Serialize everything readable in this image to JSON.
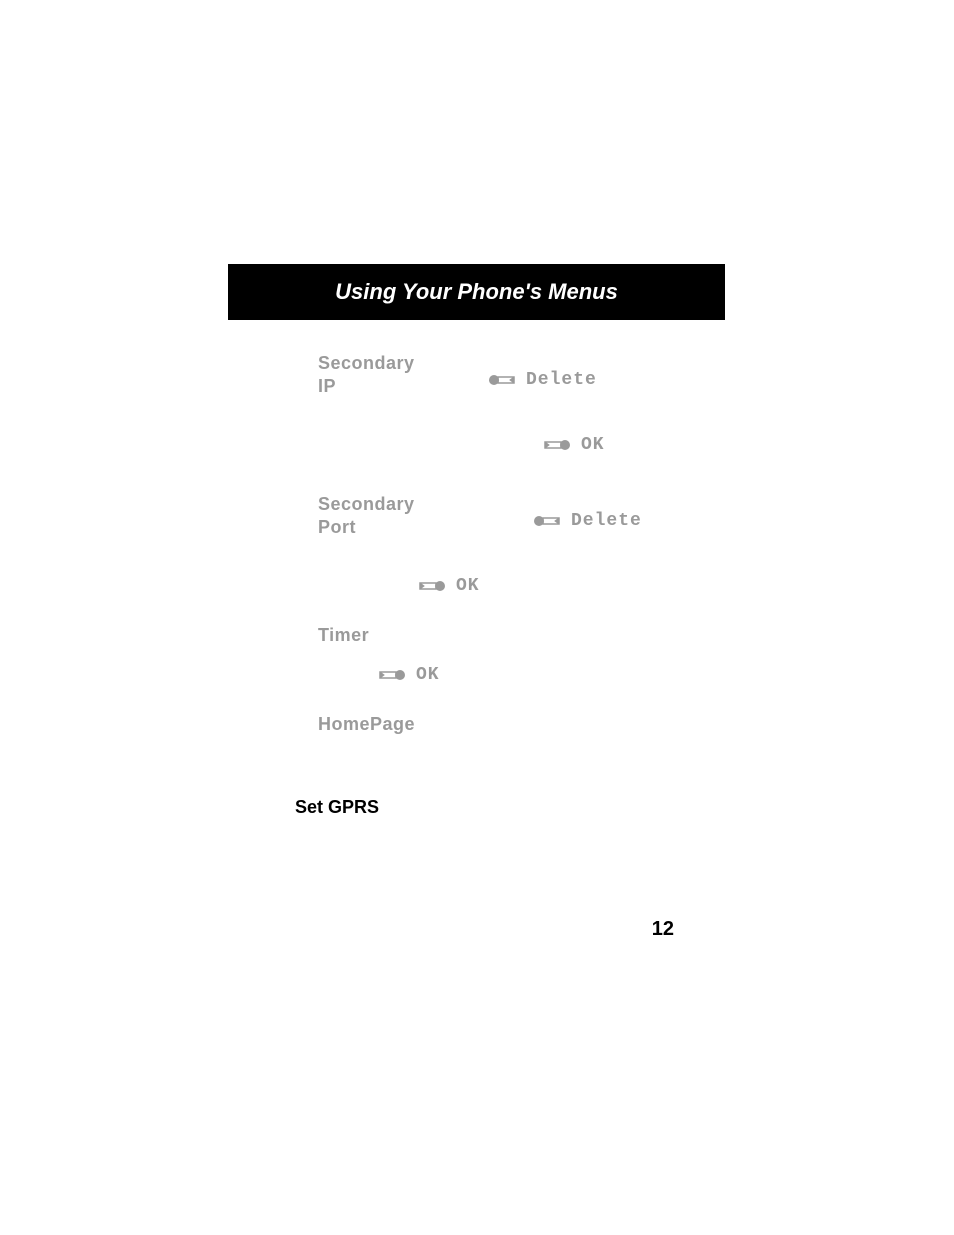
{
  "header": {
    "title": "Using Your Phone's Menus"
  },
  "items": {
    "secondary_ip": {
      "label_line1": "Secondary",
      "label_line2": "IP",
      "delete": "Delete",
      "ok": "OK"
    },
    "secondary_port": {
      "label_line1": "Secondary",
      "label_line2": "Port",
      "delete": "Delete",
      "ok": "OK"
    },
    "timer": {
      "label": "Timer",
      "ok": "OK"
    },
    "homepage": {
      "label": "HomePage"
    }
  },
  "section": {
    "set_gprs": "Set GPRS"
  },
  "page_number": "12"
}
